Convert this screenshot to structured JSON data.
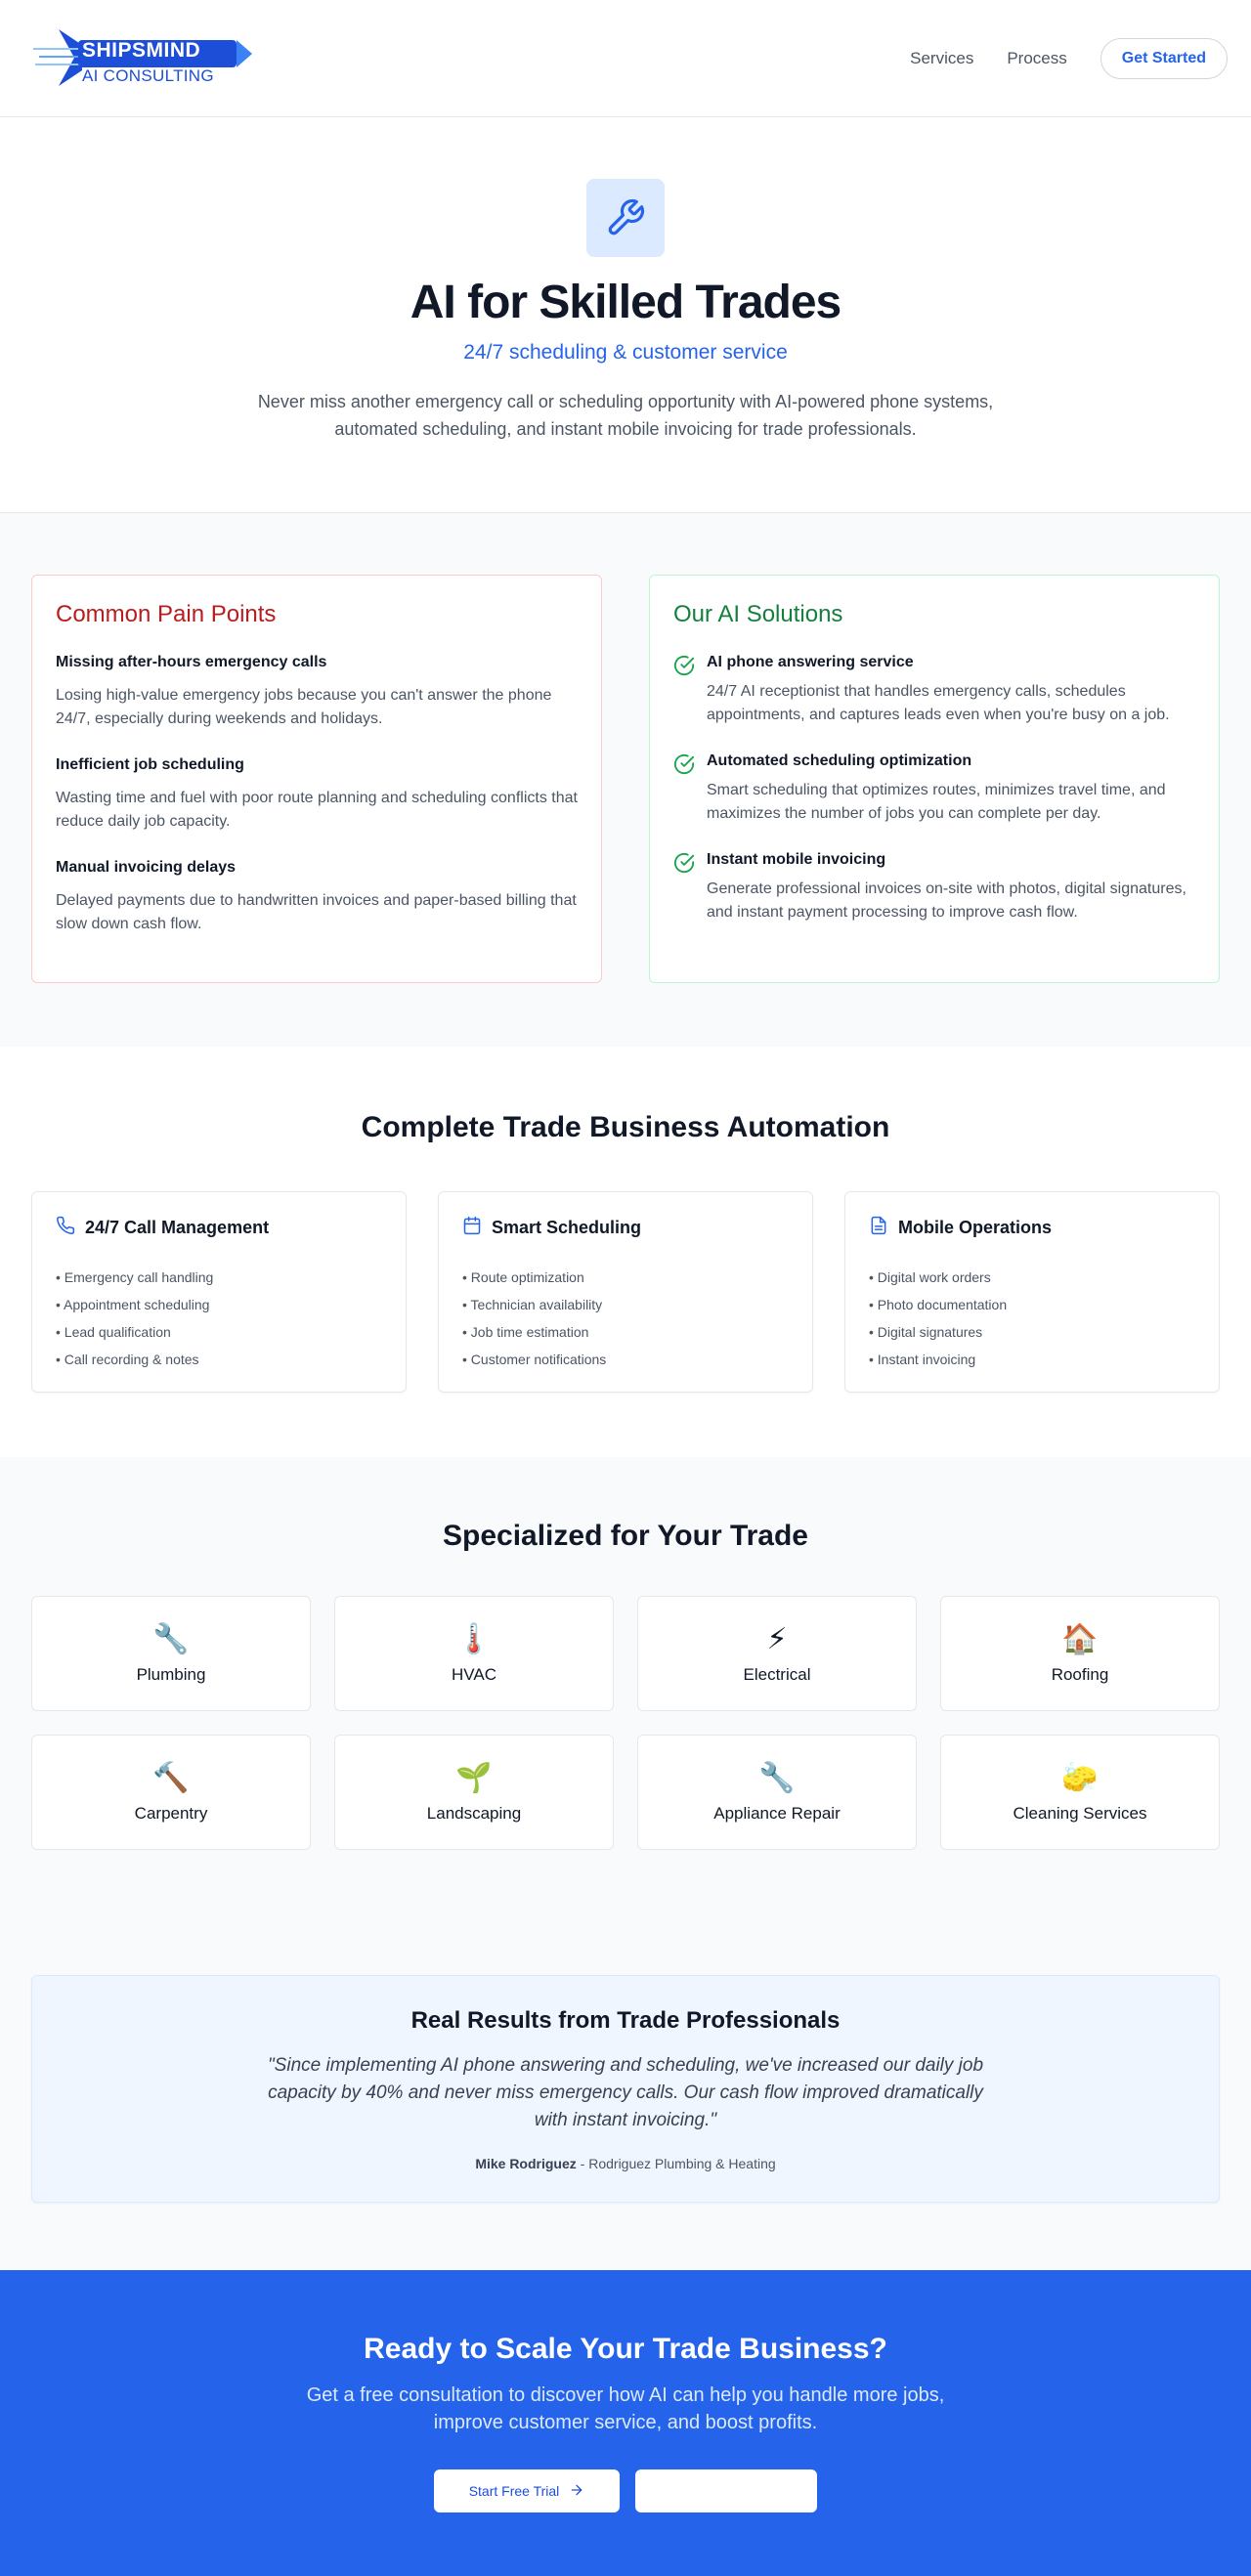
{
  "header": {
    "logo": {
      "brand": "SHIPSMIND",
      "subtitle": "AI CONSULTING"
    },
    "nav": [
      "Services",
      "Process"
    ],
    "cta_label": "Get Started"
  },
  "hero": {
    "icon": "wrench-icon",
    "title": "AI for Skilled Trades",
    "tagline": "24/7 scheduling & customer service",
    "description": "Never miss another emergency call or scheduling opportunity with AI-powered phone systems, automated scheduling, and instant mobile invoicing for trade professionals."
  },
  "pain_points": {
    "title": "Common Pain Points",
    "items": [
      {
        "title": "Missing after-hours emergency calls",
        "text": "Losing high-value emergency jobs because you can't answer the phone 24/7, especially during weekends and holidays."
      },
      {
        "title": "Inefficient job scheduling",
        "text": "Wasting time and fuel with poor route planning and scheduling conflicts that reduce daily job capacity."
      },
      {
        "title": "Manual invoicing delays",
        "text": "Delayed payments due to handwritten invoices and paper-based billing that slow down cash flow."
      }
    ]
  },
  "solutions": {
    "title": "Our AI Solutions",
    "items": [
      {
        "title": "AI phone answering service",
        "text": "24/7 AI receptionist that handles emergency calls, schedules appointments, and captures leads even when you're busy on a job."
      },
      {
        "title": "Automated scheduling optimization",
        "text": "Smart scheduling that optimizes routes, minimizes travel time, and maximizes the number of jobs you can complete per day."
      },
      {
        "title": "Instant mobile invoicing",
        "text": "Generate professional invoices on-site with photos, digital signatures, and instant payment processing to improve cash flow."
      }
    ]
  },
  "automation": {
    "title": "Complete Trade Business Automation",
    "cards": [
      {
        "icon": "phone-icon",
        "title": "24/7 Call Management",
        "items": [
          "Emergency call handling",
          "Appointment scheduling",
          "Lead qualification",
          "Call recording & notes"
        ]
      },
      {
        "icon": "calendar-icon",
        "title": "Smart Scheduling",
        "items": [
          "Route optimization",
          "Technician availability",
          "Job time estimation",
          "Customer notifications"
        ]
      },
      {
        "icon": "document-icon",
        "title": "Mobile Operations",
        "items": [
          "Digital work orders",
          "Photo documentation",
          "Digital signatures",
          "Instant invoicing"
        ]
      }
    ]
  },
  "trades": {
    "title": "Specialized for Your Trade",
    "items": [
      {
        "emoji": "🔧",
        "name": "Plumbing"
      },
      {
        "emoji": "🌡️",
        "name": "HVAC"
      },
      {
        "emoji": "⚡",
        "name": "Electrical"
      },
      {
        "emoji": "🏠",
        "name": "Roofing"
      },
      {
        "emoji": "🔨",
        "name": "Carpentry"
      },
      {
        "emoji": "🌱",
        "name": "Landscaping"
      },
      {
        "emoji": "🔧",
        "name": "Appliance Repair"
      },
      {
        "emoji": "🧽",
        "name": "Cleaning Services"
      }
    ]
  },
  "results": {
    "title": "Real Results from Trade Professionals",
    "quote": "\"Since implementing AI phone answering and scheduling, we've increased our daily job capacity by 40% and never miss emergency calls. Our cash flow improved dramatically with instant invoicing.\"",
    "author": "Mike Rodriguez",
    "company": " - Rodriguez Plumbing & Heating"
  },
  "cta": {
    "title": "Ready to Scale Your Trade Business?",
    "text": "Get a free consultation to discover how AI can help you handle more jobs, improve customer service, and boost profits.",
    "primary_label": "Start Free Trial",
    "secondary_label": ""
  },
  "colors": {
    "primary": "#2563eb",
    "pain": "#b91c1c",
    "solution": "#15803d"
  }
}
